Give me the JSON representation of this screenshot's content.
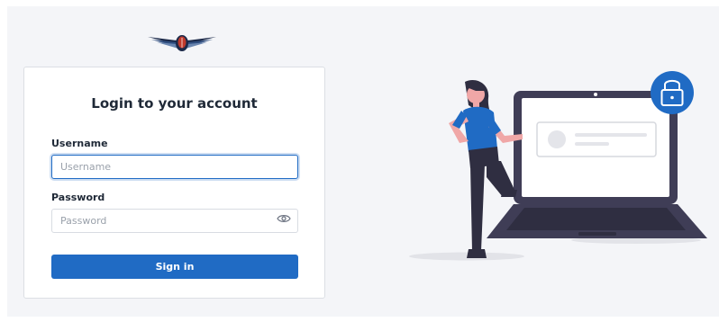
{
  "logo": {
    "icon": "winged-emblem-icon"
  },
  "login": {
    "title": "Login to your account",
    "username_label": "Username",
    "username_placeholder": "Username",
    "username_value": "",
    "password_label": "Password",
    "password_placeholder": "Password",
    "password_value": "",
    "show_password_icon": "eye-icon",
    "signin_label": "Sign in"
  },
  "illustration": {
    "description_icon": "woman-with-laptop-lock-illustration",
    "lock_icon": "lock-icon"
  },
  "colors": {
    "primary": "#206bc4",
    "background": "#f4f5f8",
    "card": "#ffffff",
    "laptop": "#3f3d56"
  }
}
